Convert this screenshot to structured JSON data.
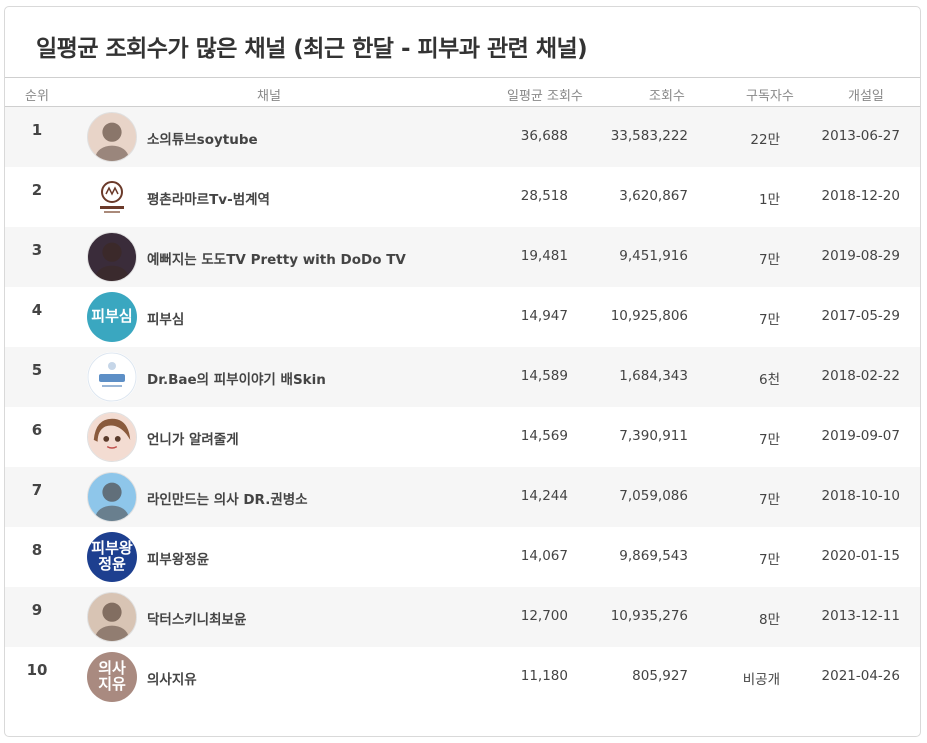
{
  "title": "일평균 조회수가 많은 채널 (최근 한달 - 피부과 관련 채널)",
  "columns": {
    "rank": "순위",
    "channel": "채널",
    "avg_views": "일평균 조회수",
    "views": "조회수",
    "subscribers": "구독자수",
    "created": "개설일"
  },
  "rows": [
    {
      "rank": "1",
      "name": "소의튜브soytube",
      "avg": "36,688",
      "views": "33,583,222",
      "subs": "22만",
      "date": "2013-06-27",
      "avatar": {
        "icon": "person-photo-icon",
        "text": "",
        "color": "#e8d4c8"
      }
    },
    {
      "rank": "2",
      "name": "평촌라마르Tv-범계역",
      "avg": "28,518",
      "views": "3,620,867",
      "subs": "1만",
      "date": "2018-12-20",
      "avatar": {
        "icon": "lamar-logo-icon",
        "text": "",
        "color": "#ffffff"
      }
    },
    {
      "rank": "3",
      "name": "예뻐지는 도도TV Pretty with DoDo TV",
      "avg": "19,481",
      "views": "9,451,916",
      "subs": "7만",
      "date": "2019-08-29",
      "avatar": {
        "icon": "person-photo-icon",
        "text": "",
        "color": "#3a2c3a"
      }
    },
    {
      "rank": "4",
      "name": "피부심",
      "avg": "14,947",
      "views": "10,925,806",
      "subs": "7만",
      "date": "2017-05-29",
      "avatar": {
        "icon": "text-logo-icon",
        "text": "피부심",
        "color": "#3aa7c0"
      }
    },
    {
      "rank": "5",
      "name": "Dr.Bae의 피부이야기 배Skin",
      "avg": "14,589",
      "views": "1,684,343",
      "subs": "6천",
      "date": "2018-02-22",
      "avatar": {
        "icon": "skin-logo-icon",
        "text": "",
        "color": "#ffffff"
      }
    },
    {
      "rank": "6",
      "name": "언니가 알려줄게",
      "avg": "14,569",
      "views": "7,390,911",
      "subs": "7만",
      "date": "2019-09-07",
      "avatar": {
        "icon": "cartoon-face-icon",
        "text": "",
        "color": "#f7e6e0"
      }
    },
    {
      "rank": "7",
      "name": "라인만드는 의사 DR.권병소",
      "avg": "14,244",
      "views": "7,059,086",
      "subs": "7만",
      "date": "2018-10-10",
      "avatar": {
        "icon": "person-photo-icon",
        "text": "",
        "color": "#8ec6ea"
      }
    },
    {
      "rank": "8",
      "name": "피부왕정윤",
      "avg": "14,067",
      "views": "9,869,543",
      "subs": "7만",
      "date": "2020-01-15",
      "avatar": {
        "icon": "text-logo-icon",
        "text": "피부왕\n정윤",
        "color": "#1d3f8f"
      }
    },
    {
      "rank": "9",
      "name": "닥터스키니최보윤",
      "avg": "12,700",
      "views": "10,935,276",
      "subs": "8만",
      "date": "2013-12-11",
      "avatar": {
        "icon": "person-photo-icon",
        "text": "",
        "color": "#d8c4b4"
      }
    },
    {
      "rank": "10",
      "name": "의사지유",
      "avg": "11,180",
      "views": "805,927",
      "subs": "비공개",
      "date": "2021-04-26",
      "avatar": {
        "icon": "text-logo-icon",
        "text": "의사\n지유",
        "color": "#a98a80"
      }
    }
  ]
}
